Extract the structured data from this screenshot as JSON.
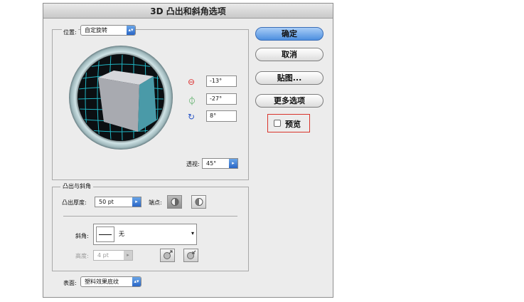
{
  "dialog": {
    "title": "3D 凸出和斜角选项"
  },
  "position": {
    "label": "位置:",
    "value": "自定旋转",
    "rot_x": "-13°",
    "rot_y": "-27°",
    "rot_z": "8°",
    "perspective_label": "透视:",
    "perspective_value": "45°"
  },
  "extrude": {
    "section_title": "凸出与斜角",
    "depth_label": "凸出厚度:",
    "depth_value": "50 pt",
    "cap_label": "端点:",
    "bevel_label": "斜角:",
    "bevel_value": "无",
    "height_label": "高度:",
    "height_value": "4 pt"
  },
  "surface": {
    "label": "表面:",
    "value": "塑料效果底纹"
  },
  "buttons": {
    "ok": "确定",
    "cancel": "取消",
    "map": "贴图...",
    "more": "更多选项"
  },
  "preview": {
    "label": "预览",
    "checked": false,
    "highlight_color": "#d9342b"
  },
  "colors": {
    "cube_front": "#4a9aa8",
    "cube_side": "#a8aab0",
    "grid": "#23c7d6",
    "accent": "#3a7bd5"
  }
}
